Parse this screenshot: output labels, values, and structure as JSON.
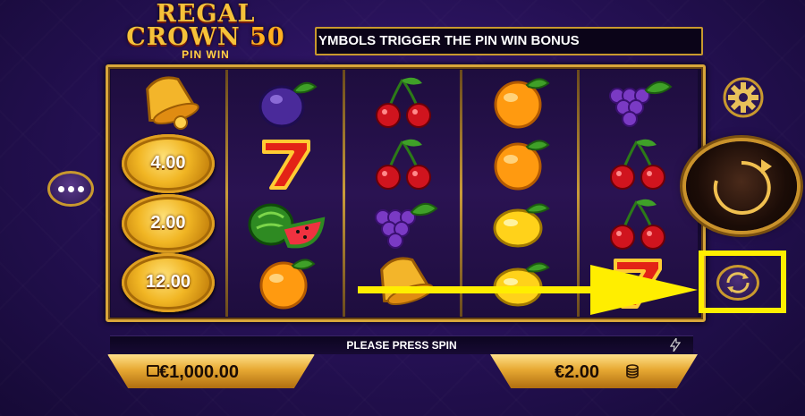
{
  "logo": {
    "line1": "REGAL",
    "line2": "CROWN",
    "line2_num": "50",
    "line3": "PIN WIN"
  },
  "ticker": {
    "text": "YMBOLS TRIGGER THE PIN WIN BONUS"
  },
  "reels": [
    [
      "bell",
      "coin",
      "coin",
      "coin"
    ],
    [
      "plum",
      "seven",
      "watermelon",
      "orange"
    ],
    [
      "cherries",
      "cherries",
      "grapes",
      "bell"
    ],
    [
      "orange",
      "orange",
      "lemon",
      "lemon"
    ],
    [
      "grapes",
      "cherries",
      "cherries",
      "seven"
    ]
  ],
  "coins": {
    "c1": "4.00",
    "c2": "2.00",
    "c3": "12.00"
  },
  "status": {
    "text": "PLEASE PRESS SPIN"
  },
  "balance": {
    "value": "€1,000.00"
  },
  "bet": {
    "value": "€2.00"
  },
  "icons": {
    "menu": "more-dots-icon",
    "settings": "gear-icon",
    "spin": "spin-icon",
    "autoplay": "autoplay-icon",
    "status": "lightning-icon",
    "balance": "wallet-icon",
    "bet": "coins-stack-icon"
  },
  "colors": {
    "gold": "#d8a63a",
    "highlight": "#ffee00",
    "bg": "#241052"
  }
}
